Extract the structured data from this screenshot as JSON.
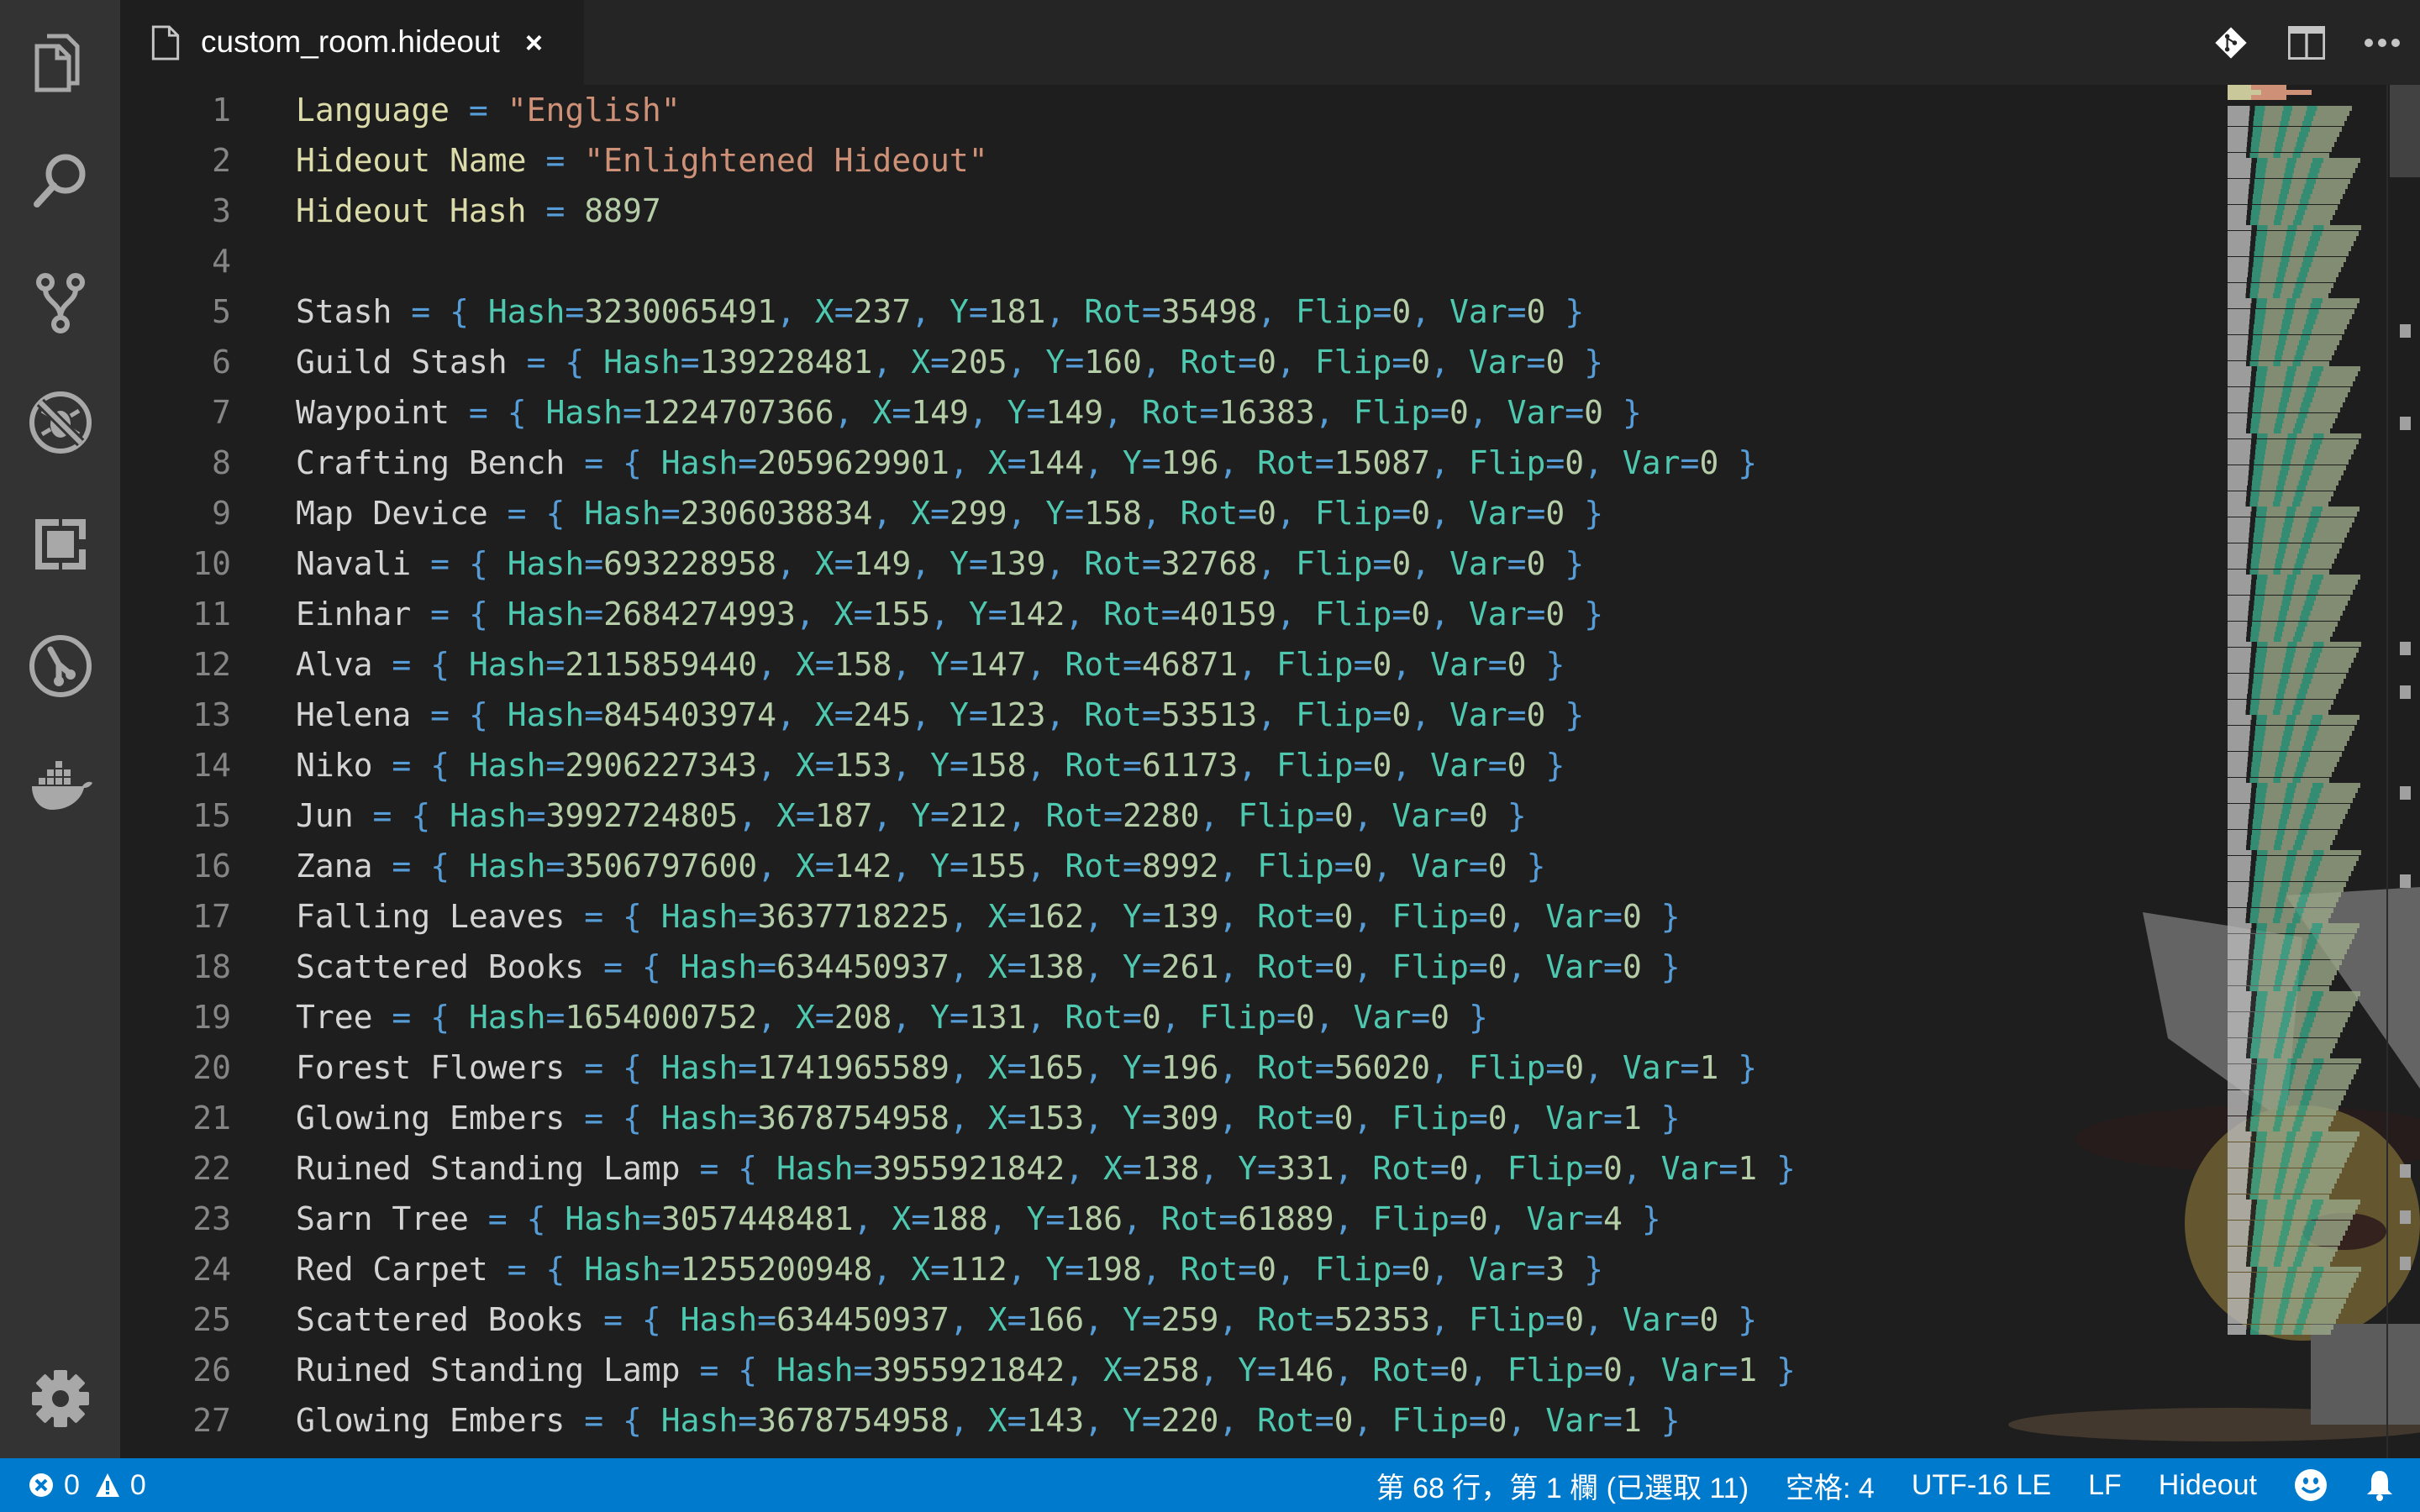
{
  "activity_bar": {
    "items": [
      {
        "name": "explorer",
        "icon": "files-icon"
      },
      {
        "name": "search",
        "icon": "search-icon"
      },
      {
        "name": "source-control",
        "icon": "source-control-icon"
      },
      {
        "name": "debug",
        "icon": "debug-icon"
      },
      {
        "name": "extensions",
        "icon": "extensions-icon"
      },
      {
        "name": "gitlens",
        "icon": "git-history-icon"
      },
      {
        "name": "docker",
        "icon": "docker-icon"
      }
    ],
    "settings_icon": "gear-icon"
  },
  "tabs": [
    {
      "label": "custom_room.hideout",
      "close": "×",
      "active": true
    }
  ],
  "tab_actions": [
    {
      "name": "git-compare",
      "icon": "git-icon"
    },
    {
      "name": "split-editor",
      "icon": "split-editor-icon"
    },
    {
      "name": "more-actions",
      "icon": "ellipsis-icon",
      "glyph": "···"
    }
  ],
  "editor": {
    "header": [
      {
        "n": "1",
        "key": "Language",
        "value": "\"English\"",
        "type": "string"
      },
      {
        "n": "2",
        "key": "Hideout Name",
        "value": "\"Enlightened Hideout\"",
        "type": "string"
      },
      {
        "n": "3",
        "key": "Hideout Hash",
        "value": "8897",
        "type": "number"
      },
      {
        "n": "4",
        "key": "",
        "value": "",
        "type": "blank"
      }
    ],
    "objects": [
      {
        "n": "5",
        "name": "Stash",
        "Hash": "3230065491",
        "X": "237",
        "Y": "181",
        "Rot": "35498",
        "Flip": "0",
        "Var": "0"
      },
      {
        "n": "6",
        "name": "Guild Stash",
        "Hash": "139228481",
        "X": "205",
        "Y": "160",
        "Rot": "0",
        "Flip": "0",
        "Var": "0"
      },
      {
        "n": "7",
        "name": "Waypoint",
        "Hash": "1224707366",
        "X": "149",
        "Y": "149",
        "Rot": "16383",
        "Flip": "0",
        "Var": "0"
      },
      {
        "n": "8",
        "name": "Crafting Bench",
        "Hash": "2059629901",
        "X": "144",
        "Y": "196",
        "Rot": "15087",
        "Flip": "0",
        "Var": "0"
      },
      {
        "n": "9",
        "name": "Map Device",
        "Hash": "2306038834",
        "X": "299",
        "Y": "158",
        "Rot": "0",
        "Flip": "0",
        "Var": "0"
      },
      {
        "n": "10",
        "name": "Navali",
        "Hash": "693228958",
        "X": "149",
        "Y": "139",
        "Rot": "32768",
        "Flip": "0",
        "Var": "0"
      },
      {
        "n": "11",
        "name": "Einhar",
        "Hash": "2684274993",
        "X": "155",
        "Y": "142",
        "Rot": "40159",
        "Flip": "0",
        "Var": "0"
      },
      {
        "n": "12",
        "name": "Alva",
        "Hash": "2115859440",
        "X": "158",
        "Y": "147",
        "Rot": "46871",
        "Flip": "0",
        "Var": "0"
      },
      {
        "n": "13",
        "name": "Helena",
        "Hash": "845403974",
        "X": "245",
        "Y": "123",
        "Rot": "53513",
        "Flip": "0",
        "Var": "0"
      },
      {
        "n": "14",
        "name": "Niko",
        "Hash": "2906227343",
        "X": "153",
        "Y": "158",
        "Rot": "61173",
        "Flip": "0",
        "Var": "0"
      },
      {
        "n": "15",
        "name": "Jun",
        "Hash": "3992724805",
        "X": "187",
        "Y": "212",
        "Rot": "2280",
        "Flip": "0",
        "Var": "0"
      },
      {
        "n": "16",
        "name": "Zana",
        "Hash": "3506797600",
        "X": "142",
        "Y": "155",
        "Rot": "8992",
        "Flip": "0",
        "Var": "0"
      },
      {
        "n": "17",
        "name": "Falling Leaves",
        "Hash": "3637718225",
        "X": "162",
        "Y": "139",
        "Rot": "0",
        "Flip": "0",
        "Var": "0"
      },
      {
        "n": "18",
        "name": "Scattered Books",
        "Hash": "634450937",
        "X": "138",
        "Y": "261",
        "Rot": "0",
        "Flip": "0",
        "Var": "0"
      },
      {
        "n": "19",
        "name": "Tree",
        "Hash": "1654000752",
        "X": "208",
        "Y": "131",
        "Rot": "0",
        "Flip": "0",
        "Var": "0"
      },
      {
        "n": "20",
        "name": "Forest Flowers",
        "Hash": "1741965589",
        "X": "165",
        "Y": "196",
        "Rot": "56020",
        "Flip": "0",
        "Var": "1"
      },
      {
        "n": "21",
        "name": "Glowing Embers",
        "Hash": "3678754958",
        "X": "153",
        "Y": "309",
        "Rot": "0",
        "Flip": "0",
        "Var": "1"
      },
      {
        "n": "22",
        "name": "Ruined Standing Lamp",
        "Hash": "3955921842",
        "X": "138",
        "Y": "331",
        "Rot": "0",
        "Flip": "0",
        "Var": "1"
      },
      {
        "n": "23",
        "name": "Sarn Tree",
        "Hash": "3057448481",
        "X": "188",
        "Y": "186",
        "Rot": "61889",
        "Flip": "0",
        "Var": "4"
      },
      {
        "n": "24",
        "name": "Red Carpet",
        "Hash": "1255200948",
        "X": "112",
        "Y": "198",
        "Rot": "0",
        "Flip": "0",
        "Var": "3"
      },
      {
        "n": "25",
        "name": "Scattered Books",
        "Hash": "634450937",
        "X": "166",
        "Y": "259",
        "Rot": "52353",
        "Flip": "0",
        "Var": "0"
      },
      {
        "n": "26",
        "name": "Ruined Standing Lamp",
        "Hash": "3955921842",
        "X": "258",
        "Y": "146",
        "Rot": "0",
        "Flip": "0",
        "Var": "1"
      },
      {
        "n": "27",
        "name": "Glowing Embers",
        "Hash": "3678754958",
        "X": "143",
        "Y": "220",
        "Rot": "0",
        "Flip": "0",
        "Var": "1"
      }
    ]
  },
  "statusbar": {
    "errors": "0",
    "warnings": "0",
    "cursor_position": "第 68 行，第 1 欄 (已選取 11)",
    "indentation": "空格: 4",
    "encoding": "UTF-16 LE",
    "eol": "LF",
    "language": "Hideout",
    "feedback_icon": "smiley-icon",
    "notifications_icon": "bell-icon"
  },
  "colors": {
    "status_bar": "#007acc",
    "activity_bar": "#333333",
    "editor_bg": "#1e1e1e",
    "tab_bar": "#252526",
    "keyword_yellow": "#dcdcaa",
    "string": "#ce9178",
    "number": "#b5cea8",
    "property": "#4ec9b0",
    "operator": "#569cd6"
  }
}
